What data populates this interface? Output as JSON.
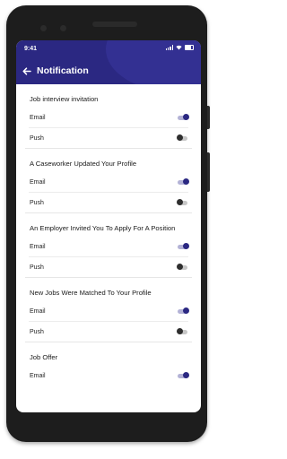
{
  "status_bar": {
    "time": "9:41"
  },
  "header": {
    "title": "Notification",
    "back_icon": "arrow-left-icon"
  },
  "colors": {
    "header_bg": "#2b2882",
    "toggle_on": "#2b2882",
    "toggle_off": "#2e2e2e"
  },
  "sections": [
    {
      "title": "Job interview invitation",
      "rows": [
        {
          "label": "Email",
          "on": true
        },
        {
          "label": "Push",
          "on": false
        }
      ]
    },
    {
      "title": "A Caseworker Updated Your Profile",
      "rows": [
        {
          "label": "Email",
          "on": true
        },
        {
          "label": "Push",
          "on": false
        }
      ]
    },
    {
      "title": "An Employer Invited You To Apply For A Position",
      "rows": [
        {
          "label": "Email",
          "on": true
        },
        {
          "label": "Push",
          "on": false
        }
      ]
    },
    {
      "title": "New Jobs Were Matched To Your Profile",
      "rows": [
        {
          "label": "Email",
          "on": true
        },
        {
          "label": "Push",
          "on": false
        }
      ]
    },
    {
      "title": "Job Offer",
      "rows": [
        {
          "label": "Email",
          "on": true
        }
      ]
    }
  ]
}
